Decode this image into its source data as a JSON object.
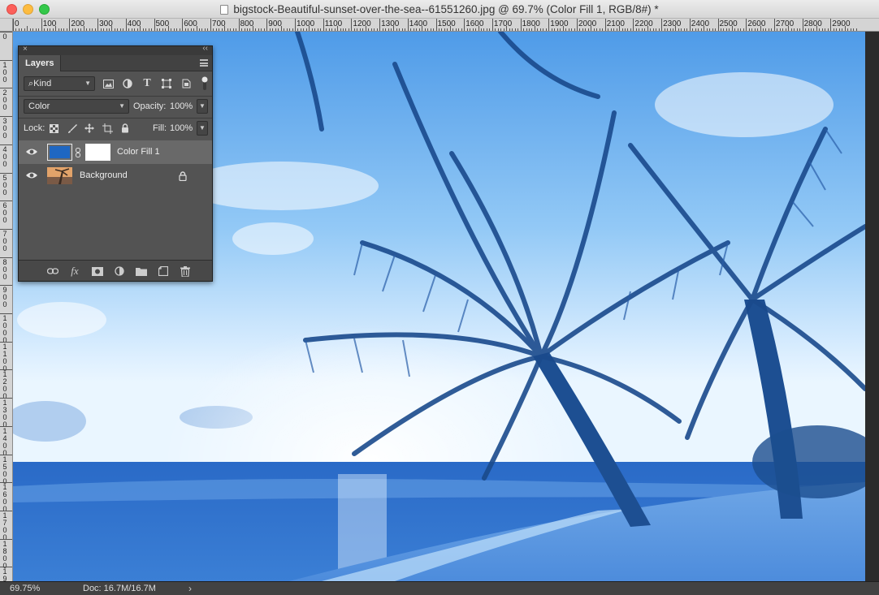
{
  "window": {
    "title": "bigstock-Beautiful-sunset-over-the-sea--61551260.jpg @ 69.7% (Color Fill 1, RGB/8#) *"
  },
  "ruler": {
    "top_labels": [
      "0",
      "100",
      "200",
      "300",
      "400",
      "500",
      "600",
      "700",
      "800",
      "900",
      "1000",
      "1100",
      "1200",
      "1300",
      "1400",
      "1500",
      "1600",
      "1700",
      "1800",
      "1900",
      "2000",
      "2100",
      "2200",
      "2300",
      "2400",
      "2500",
      "2600",
      "2700",
      "2800",
      "2900"
    ],
    "left_labels": [
      "0",
      "1 0 0",
      "2 0 0",
      "3 0 0",
      "4 0 0",
      "5 0 0",
      "6 0 0",
      "7 0 0",
      "8 0 0",
      "9 0 0",
      "1 0 0 0",
      "1 1 0 0",
      "1 2 0 0",
      "1 3 0 0",
      "1 4 0 0",
      "1 5 0 0",
      "1 6 0 0",
      "1 7 0 0",
      "1 8 0 0",
      "1 9 0 0"
    ]
  },
  "status": {
    "zoom": "69.75%",
    "doc": "Doc: 16.7M/16.7M",
    "arrow": "›"
  },
  "layers_panel": {
    "tab_label": "Layers",
    "close_glyph": "×",
    "collapse_glyph": "‹‹",
    "filter": {
      "icon": "search-icon",
      "value": "Kind"
    },
    "filter_icons": [
      "image-filter-icon",
      "adjustment-filter-icon",
      "type-filter-icon",
      "shape-filter-icon",
      "smart-object-filter-icon"
    ],
    "blend_mode": "Color",
    "opacity_label": "Opacity:",
    "opacity_value": "100%",
    "lock_label": "Lock:",
    "fill_label": "Fill:",
    "fill_value": "100%",
    "layers": [
      {
        "name": "Color Fill 1",
        "visible": true,
        "selected": true,
        "fill_color": "#1f67c2"
      },
      {
        "name": "Background",
        "visible": true,
        "selected": false,
        "locked": true
      }
    ],
    "footer_icons": [
      "link-layers-icon",
      "fx-icon",
      "add-mask-icon",
      "adjustment-layer-icon",
      "new-group-icon",
      "new-layer-icon",
      "trash-icon"
    ]
  },
  "colors": {
    "accent": "#1f67c2",
    "panel_bg": "#535353"
  }
}
